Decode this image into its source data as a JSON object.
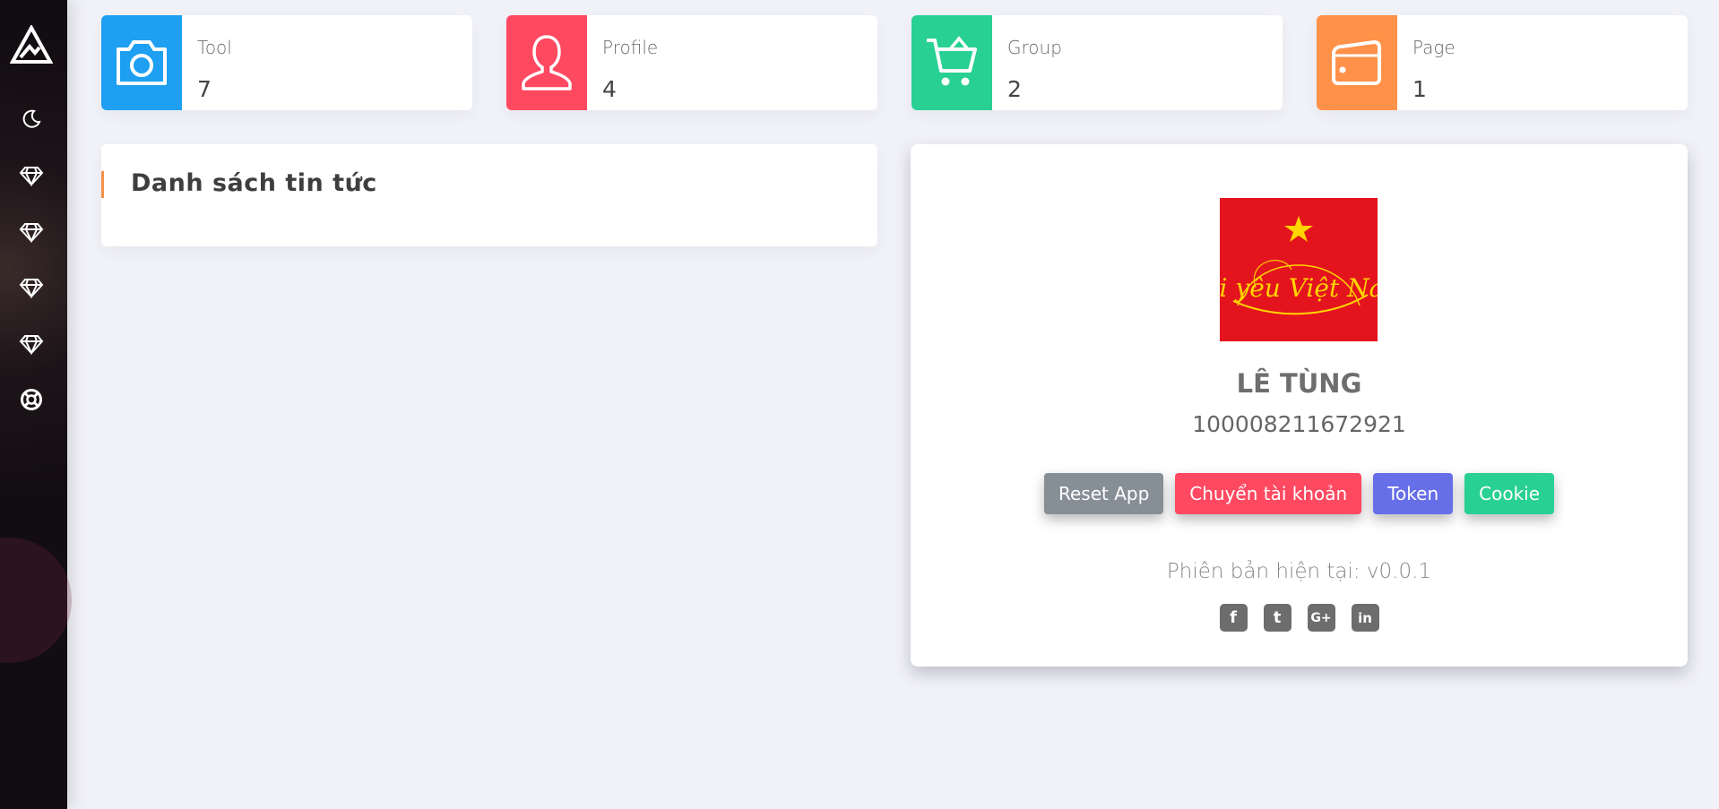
{
  "sidebar": {
    "items": [
      {
        "icon": "logo-mountain-icon"
      },
      {
        "icon": "moon-icon"
      },
      {
        "icon": "diamond-icon"
      },
      {
        "icon": "diamond-icon"
      },
      {
        "icon": "diamond-icon"
      },
      {
        "icon": "diamond-icon"
      },
      {
        "icon": "lifebuoy-icon"
      }
    ]
  },
  "stats": [
    {
      "label": "Tool",
      "value": "7",
      "icon": "camera-icon",
      "color": "#1e9ff2"
    },
    {
      "label": "Profile",
      "value": "4",
      "icon": "user-icon",
      "color": "#ff4961"
    },
    {
      "label": "Group",
      "value": "2",
      "icon": "cart-icon",
      "color": "#28d094"
    },
    {
      "label": "Page",
      "value": "1",
      "icon": "wallet-icon",
      "color": "#ff9149"
    }
  ],
  "news": {
    "title": "Danh sách tin tức"
  },
  "profile": {
    "name": "LÊ TÙNG",
    "id": "100008211672921",
    "avatar_text": "Tôi yêu Việt Nam",
    "buttons": [
      {
        "label": "Reset App",
        "color": "#868e96"
      },
      {
        "label": "Chuyển tài khoản",
        "color": "#ff4961"
      },
      {
        "label": "Token",
        "color": "#666ee8"
      },
      {
        "label": "Cookie",
        "color": "#28d094"
      }
    ],
    "version": "Phiên bản hiện tại: v0.0.1",
    "social": [
      {
        "icon": "facebook-icon",
        "glyph": "f"
      },
      {
        "icon": "twitter-icon",
        "glyph": "t"
      },
      {
        "icon": "google-plus-icon",
        "glyph": "G+"
      },
      {
        "icon": "linkedin-icon",
        "glyph": "in"
      }
    ]
  }
}
